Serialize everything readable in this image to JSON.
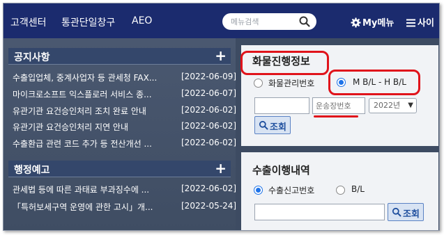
{
  "topnav": {
    "links": [
      "고객센터",
      "통관단일창구",
      "AEO"
    ],
    "search_placeholder": "메뉴검색",
    "mymenu_label": "My메뉴",
    "sitemap_label": "사이"
  },
  "notices": {
    "title": "공지사항",
    "more": "+",
    "items": [
      {
        "title": "수출입업체, 중계사업자 등 관세청 FAX...",
        "date": "[2022-06-09]"
      },
      {
        "title": "마이크로소프트 익스플로러 서비스 종...",
        "date": "[2022-06-07]"
      },
      {
        "title": "유관기관 요건승인처리 조치 완료 안내",
        "date": "[2022-06-02]"
      },
      {
        "title": "유관기관 요건승인처리 지연 안내",
        "date": "[2022-06-02]"
      },
      {
        "title": "수출환급 관련 코드 추가 등 전산개선 ...",
        "date": "[2022-06-02]"
      }
    ]
  },
  "legislation": {
    "title": "행정예고",
    "more": "+",
    "items": [
      {
        "title": "관세법 등에 따른 과태료 부과징수에 ...",
        "date": "[2022-06-02]"
      },
      {
        "title": "「특허보세구역 운영에 관한 고시」개...",
        "date": "[2022-05-24]"
      }
    ]
  },
  "cargo": {
    "title": "화물진행정보",
    "radio_cargo_no": "화물관리번호",
    "radio_bl": "M B/L - H B/L",
    "waybill_label": "운송장번호",
    "year_value": "2022년",
    "query_label": "조회"
  },
  "export": {
    "title": "수출이행내역",
    "radio_decl_no": "수출신고번호",
    "radio_bl": "B/L",
    "query_label": "조회"
  },
  "colors": {
    "nav_bg": "#1b2b6e",
    "highlight": "#e0131b",
    "radio_selected": "#1e73e8"
  }
}
